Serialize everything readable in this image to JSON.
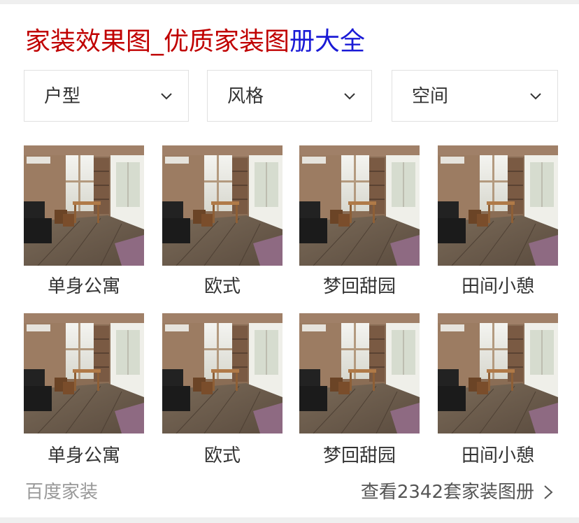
{
  "title": {
    "part_red": "家装效果图_优质家装图",
    "part_blue": "册大全"
  },
  "filters": [
    {
      "label": "户型",
      "icon": "chevron-down-icon"
    },
    {
      "label": "风格",
      "icon": "chevron-down-icon"
    },
    {
      "label": "空间",
      "icon": "chevron-down-icon"
    }
  ],
  "gallery": {
    "rows": [
      [
        "单身公寓",
        "欧式",
        "梦回甜园",
        "田间小憩"
      ],
      [
        "单身公寓",
        "欧式",
        "梦回甜园",
        "田间小憩"
      ]
    ]
  },
  "footer": {
    "brand": "百度家装",
    "more_link": "查看2342套家装图册",
    "more_icon": "chevron-right-icon"
  },
  "colors": {
    "title_red": "#c00000",
    "title_blue": "#1a1ad6",
    "text": "#333333",
    "muted": "#999999"
  }
}
